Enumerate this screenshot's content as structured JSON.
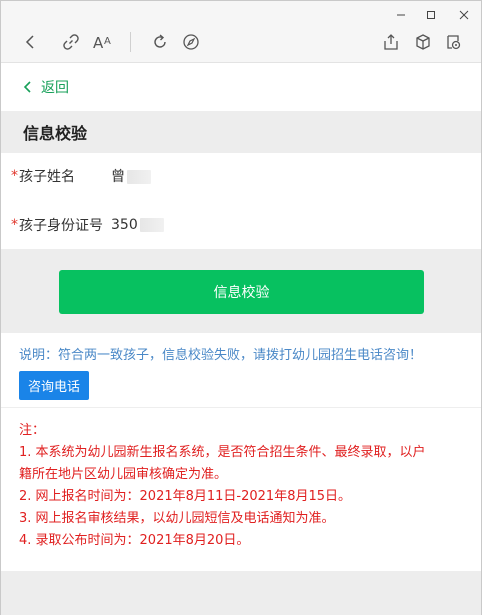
{
  "toolbar": {
    "window_controls": [
      "minimize-icon",
      "maximize-icon",
      "close-icon"
    ],
    "icons": [
      "back-icon",
      "link-icon",
      "font-size-icon",
      "refresh-icon",
      "compass-icon",
      "share-icon",
      "cube-icon",
      "profile-window-icon"
    ]
  },
  "nav": {
    "back_label": "返回"
  },
  "form": {
    "section_title": "信息校验",
    "required_mark": "*",
    "fields": [
      {
        "label": "孩子姓名",
        "value": "曾"
      },
      {
        "label": "孩子身份证号",
        "value": "350"
      }
    ]
  },
  "actions": {
    "verify_label": "信息校验"
  },
  "notice": {
    "text": "说明：符合两一致孩子，信息校验失败，请拨打幼儿园招生电话咨询！",
    "consult_label": "咨询电话"
  },
  "notes": {
    "heading": "注：",
    "items": [
      "1. 本系统为幼儿园新生报名系统，是否符合招生条件、最终录取，以户",
      "籍所在地片区幼儿园审核确定为准。",
      "2. 网上报名时间为：2021年8月11日-2021年8月15日。",
      "3. 网上报名审核结果，以幼儿园短信及电话通知为准。",
      "4. 录取公布时间为：2021年8月20日。"
    ]
  },
  "colors": {
    "accent_green": "#07c160",
    "back_green": "#18a05a",
    "notice_blue": "#4a88c7",
    "button_blue": "#1a84e8",
    "note_red": "#e02020",
    "required_red": "#e0352b"
  }
}
